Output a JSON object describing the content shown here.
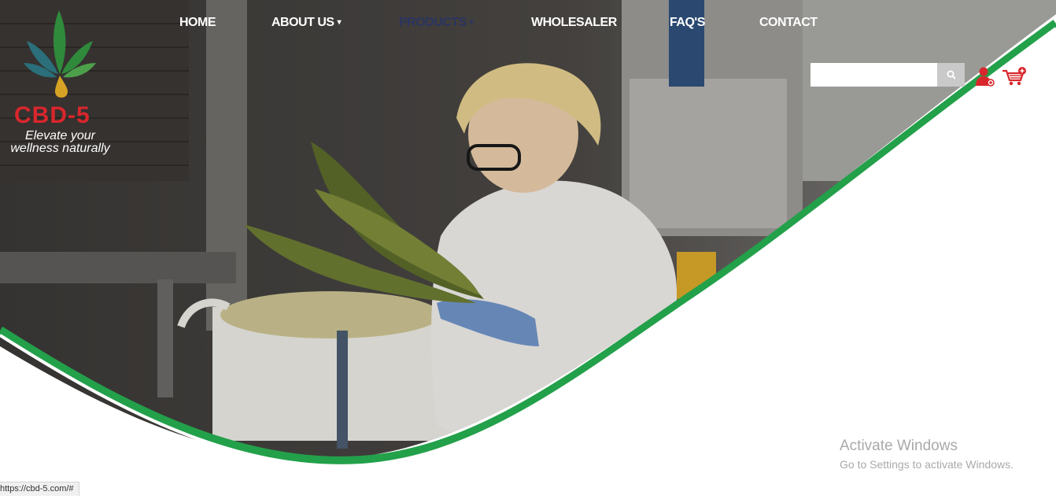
{
  "brand": {
    "name": "CBD-5",
    "tagline": "Elevate your wellness naturally"
  },
  "nav": {
    "home": "HOME",
    "about": "ABOUT US",
    "products": "PRODUCTS",
    "wholesaler": "WHOLESALER",
    "faqs": "FAQ'S",
    "contact": "CONTACT",
    "active": "products"
  },
  "search": {
    "value": "",
    "placeholder": "",
    "icon": "search-icon"
  },
  "header_icons": {
    "account": "user-icon",
    "cart": "cart-icon"
  },
  "colors": {
    "accent_green": "#23a04a",
    "brand_red": "#d9262c",
    "nav_active": "#2b3560"
  },
  "windows_watermark": {
    "title": "Activate Windows",
    "subtitle": "Go to Settings to activate Windows."
  },
  "status_bar": {
    "url": "https://cbd-5.com/#"
  }
}
